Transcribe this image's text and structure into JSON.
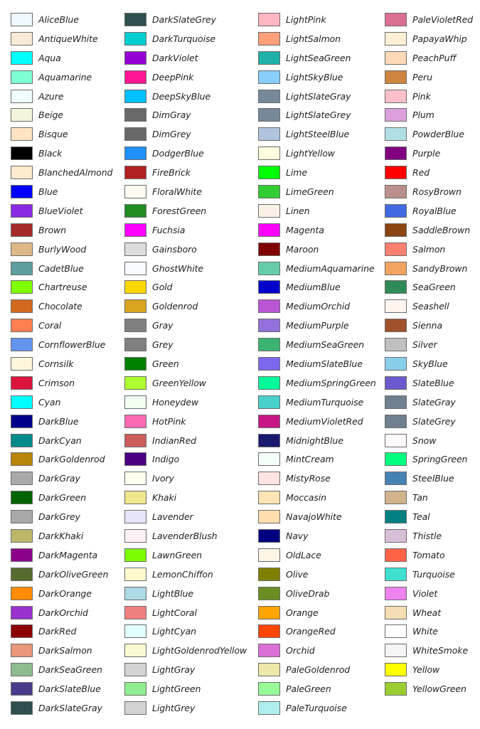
{
  "columns": [
    [
      {
        "name": "AliceBlue",
        "color": "#F0F8FF"
      },
      {
        "name": "AntiqueWhite",
        "color": "#FAEBD7"
      },
      {
        "name": "Aqua",
        "color": "#00FFFF"
      },
      {
        "name": "Aquamarine",
        "color": "#7FFFD4"
      },
      {
        "name": "Azure",
        "color": "#F0FFFF"
      },
      {
        "name": "Beige",
        "color": "#F5F5DC"
      },
      {
        "name": "Bisque",
        "color": "#FFE4C4"
      },
      {
        "name": "Black",
        "color": "#000000"
      },
      {
        "name": "BlanchedAlmond",
        "color": "#FFEBCD"
      },
      {
        "name": "Blue",
        "color": "#0000FF"
      },
      {
        "name": "BlueViolet",
        "color": "#8A2BE2"
      },
      {
        "name": "Brown",
        "color": "#A52A2A"
      },
      {
        "name": "BurlyWood",
        "color": "#DEB887"
      },
      {
        "name": "CadetBlue",
        "color": "#5F9EA0"
      },
      {
        "name": "Chartreuse",
        "color": "#7FFF00"
      },
      {
        "name": "Chocolate",
        "color": "#D2691E"
      },
      {
        "name": "Coral",
        "color": "#FF7F50"
      },
      {
        "name": "CornflowerBlue",
        "color": "#6495ED"
      },
      {
        "name": "Cornsilk",
        "color": "#FFF8DC"
      },
      {
        "name": "Crimson",
        "color": "#DC143C"
      },
      {
        "name": "Cyan",
        "color": "#00FFFF"
      },
      {
        "name": "DarkBlue",
        "color": "#00008B"
      },
      {
        "name": "DarkCyan",
        "color": "#008B8B"
      },
      {
        "name": "DarkGoldenrod",
        "color": "#B8860B"
      },
      {
        "name": "DarkGray",
        "color": "#A9A9A9"
      },
      {
        "name": "DarkGreen",
        "color": "#006400"
      },
      {
        "name": "DarkGrey",
        "color": "#A9A9A9"
      },
      {
        "name": "DarkKhaki",
        "color": "#BDB76B"
      },
      {
        "name": "DarkMagenta",
        "color": "#8B008B"
      },
      {
        "name": "DarkOliveGreen",
        "color": "#556B2F"
      },
      {
        "name": "DarkOrange",
        "color": "#FF8C00"
      },
      {
        "name": "DarkOrchid",
        "color": "#9932CC"
      },
      {
        "name": "DarkRed",
        "color": "#8B0000"
      },
      {
        "name": "DarkSalmon",
        "color": "#E9967A"
      },
      {
        "name": "DarkSeaGreen",
        "color": "#8FBC8F"
      },
      {
        "name": "DarkSlateBlue",
        "color": "#483D8B"
      },
      {
        "name": "DarkSlateGray",
        "color": "#2F4F4F"
      }
    ],
    [
      {
        "name": "DarkSlateGrey",
        "color": "#2F4F4F"
      },
      {
        "name": "DarkTurquoise",
        "color": "#00CED1"
      },
      {
        "name": "DarkViolet",
        "color": "#9400D3"
      },
      {
        "name": "DeepPink",
        "color": "#FF1493"
      },
      {
        "name": "DeepSkyBlue",
        "color": "#00BFFF"
      },
      {
        "name": "DimGray",
        "color": "#696969"
      },
      {
        "name": "DimGrey",
        "color": "#696969"
      },
      {
        "name": "DodgerBlue",
        "color": "#1E90FF"
      },
      {
        "name": "FireBrick",
        "color": "#B22222"
      },
      {
        "name": "FloralWhite",
        "color": "#FFFAF0"
      },
      {
        "name": "ForestGreen",
        "color": "#228B22"
      },
      {
        "name": "Fuchsia",
        "color": "#FF00FF"
      },
      {
        "name": "Gainsboro",
        "color": "#DCDCDC"
      },
      {
        "name": "GhostWhite",
        "color": "#F8F8FF"
      },
      {
        "name": "Gold",
        "color": "#FFD700"
      },
      {
        "name": "Goldenrod",
        "color": "#DAA520"
      },
      {
        "name": "Gray",
        "color": "#808080"
      },
      {
        "name": "Grey",
        "color": "#808080"
      },
      {
        "name": "Green",
        "color": "#008000"
      },
      {
        "name": "GreenYellow",
        "color": "#ADFF2F"
      },
      {
        "name": "Honeydew",
        "color": "#F0FFF0"
      },
      {
        "name": "HotPink",
        "color": "#FF69B4"
      },
      {
        "name": "IndianRed",
        "color": "#CD5C5C"
      },
      {
        "name": "Indigo",
        "color": "#4B0082"
      },
      {
        "name": "Ivory",
        "color": "#FFFFF0"
      },
      {
        "name": "Khaki",
        "color": "#F0E68C"
      },
      {
        "name": "Lavender",
        "color": "#E6E6FA"
      },
      {
        "name": "LavenderBlush",
        "color": "#FFF0F5"
      },
      {
        "name": "LawnGreen",
        "color": "#7CFC00"
      },
      {
        "name": "LemonChiffon",
        "color": "#FFFACD"
      },
      {
        "name": "LightBlue",
        "color": "#ADD8E6"
      },
      {
        "name": "LightCoral",
        "color": "#F08080"
      },
      {
        "name": "LightCyan",
        "color": "#E0FFFF"
      },
      {
        "name": "LightGoldenrodYellow",
        "color": "#FAFAD2"
      },
      {
        "name": "LightGray",
        "color": "#D3D3D3"
      },
      {
        "name": "LightGreen",
        "color": "#90EE90"
      },
      {
        "name": "LightGrey",
        "color": "#D3D3D3"
      }
    ],
    [
      {
        "name": "LightPink",
        "color": "#FFB6C1"
      },
      {
        "name": "LightSalmon",
        "color": "#FFA07A"
      },
      {
        "name": "LightSeaGreen",
        "color": "#20B2AA"
      },
      {
        "name": "LightSkyBlue",
        "color": "#87CEFA"
      },
      {
        "name": "LightSlateGray",
        "color": "#778899"
      },
      {
        "name": "LightSlateGrey",
        "color": "#778899"
      },
      {
        "name": "LightSteelBlue",
        "color": "#B0C4DE"
      },
      {
        "name": "LightYellow",
        "color": "#FFFFE0"
      },
      {
        "name": "Lime",
        "color": "#00FF00"
      },
      {
        "name": "LimeGreen",
        "color": "#32CD32"
      },
      {
        "name": "Linen",
        "color": "#FAF0E6"
      },
      {
        "name": "Magenta",
        "color": "#FF00FF"
      },
      {
        "name": "Maroon",
        "color": "#800000"
      },
      {
        "name": "MediumAquamarine",
        "color": "#66CDAA"
      },
      {
        "name": "MediumBlue",
        "color": "#0000CD"
      },
      {
        "name": "MediumOrchid",
        "color": "#BA55D3"
      },
      {
        "name": "MediumPurple",
        "color": "#9370DB"
      },
      {
        "name": "MediumSeaGreen",
        "color": "#3CB371"
      },
      {
        "name": "MediumSlateBlue",
        "color": "#7B68EE"
      },
      {
        "name": "MediumSpringGreen",
        "color": "#00FA9A"
      },
      {
        "name": "MediumTurquoise",
        "color": "#48D1CC"
      },
      {
        "name": "MediumVioletRed",
        "color": "#C71585"
      },
      {
        "name": "MidnightBlue",
        "color": "#191970"
      },
      {
        "name": "MintCream",
        "color": "#F5FFFA"
      },
      {
        "name": "MistyRose",
        "color": "#FFE4E1"
      },
      {
        "name": "Moccasin",
        "color": "#FFE4B5"
      },
      {
        "name": "NavajoWhite",
        "color": "#FFDEAD"
      },
      {
        "name": "Navy",
        "color": "#000080"
      },
      {
        "name": "OldLace",
        "color": "#FDF5E6"
      },
      {
        "name": "Olive",
        "color": "#808000"
      },
      {
        "name": "OliveDrab",
        "color": "#6B8E23"
      },
      {
        "name": "Orange",
        "color": "#FFA500"
      },
      {
        "name": "OrangeRed",
        "color": "#FF4500"
      },
      {
        "name": "Orchid",
        "color": "#DA70D6"
      },
      {
        "name": "PaleGoldenrod",
        "color": "#EEE8AA"
      },
      {
        "name": "PaleGreen",
        "color": "#98FB98"
      },
      {
        "name": "PaleTurquoise",
        "color": "#AFEEEE"
      }
    ],
    [
      {
        "name": "PaleVioletRed",
        "color": "#DB7093"
      },
      {
        "name": "PapayaWhip",
        "color": "#FFEFD5"
      },
      {
        "name": "PeachPuff",
        "color": "#FFDAB9"
      },
      {
        "name": "Peru",
        "color": "#CD853F"
      },
      {
        "name": "Pink",
        "color": "#FFC0CB"
      },
      {
        "name": "Plum",
        "color": "#DDA0DD"
      },
      {
        "name": "PowderBlue",
        "color": "#B0E0E6"
      },
      {
        "name": "Purple",
        "color": "#800080"
      },
      {
        "name": "Red",
        "color": "#FF0000"
      },
      {
        "name": "RosyBrown",
        "color": "#BC8F8F"
      },
      {
        "name": "RoyalBlue",
        "color": "#4169E1"
      },
      {
        "name": "SaddleBrown",
        "color": "#8B4513"
      },
      {
        "name": "Salmon",
        "color": "#FA8072"
      },
      {
        "name": "SandyBrown",
        "color": "#F4A460"
      },
      {
        "name": "SeaGreen",
        "color": "#2E8B57"
      },
      {
        "name": "Seashell",
        "color": "#FFF5EE"
      },
      {
        "name": "Sienna",
        "color": "#A0522D"
      },
      {
        "name": "Silver",
        "color": "#C0C0C0"
      },
      {
        "name": "SkyBlue",
        "color": "#87CEEB"
      },
      {
        "name": "SlateBlue",
        "color": "#6A5ACD"
      },
      {
        "name": "SlateGray",
        "color": "#708090"
      },
      {
        "name": "SlateGrey",
        "color": "#708090"
      },
      {
        "name": "Snow",
        "color": "#FFFAFA"
      },
      {
        "name": "SpringGreen",
        "color": "#00FF7F"
      },
      {
        "name": "SteelBlue",
        "color": "#4682B4"
      },
      {
        "name": "Tan",
        "color": "#D2B48C"
      },
      {
        "name": "Teal",
        "color": "#008080"
      },
      {
        "name": "Thistle",
        "color": "#D8BFD8"
      },
      {
        "name": "Tomato",
        "color": "#FF6347"
      },
      {
        "name": "Turquoise",
        "color": "#40E0D0"
      },
      {
        "name": "Violet",
        "color": "#EE82EE"
      },
      {
        "name": "Wheat",
        "color": "#F5DEB3"
      },
      {
        "name": "White",
        "color": "#FFFFFF"
      },
      {
        "name": "WhiteSmoke",
        "color": "#F5F5F5"
      },
      {
        "name": "Yellow",
        "color": "#FFFF00"
      },
      {
        "name": "YellowGreen",
        "color": "#9ACD32"
      }
    ]
  ]
}
